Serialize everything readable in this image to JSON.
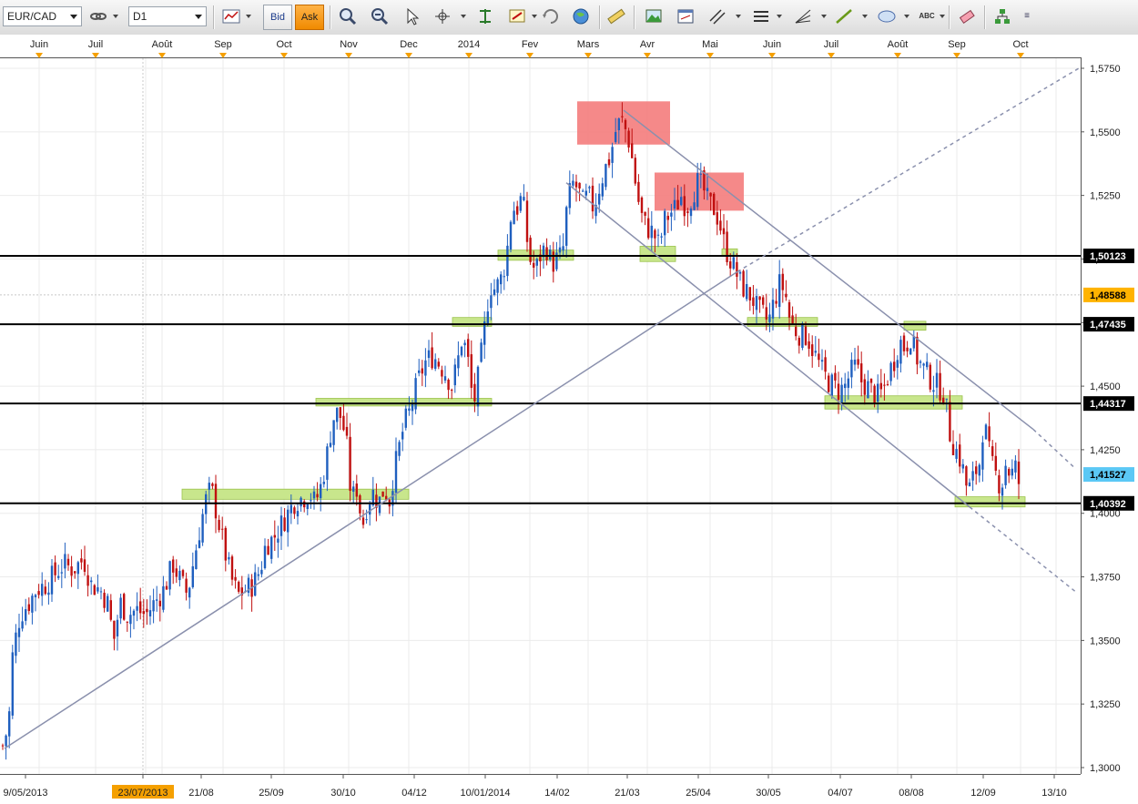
{
  "toolbar": {
    "symbol": "EUR/CAD",
    "timeframe": "D1",
    "bid_label": "Bid",
    "ask_label": "Ask",
    "abc_label": "ABC"
  },
  "colors": {
    "bull": "#1f5fbf",
    "bear": "#c01010",
    "zone_green": "#c8e68c",
    "zone_red": "#f47c7c",
    "trendline": "#8a90ad",
    "orange_marker": "#f5a000",
    "current_price_bg": "#5bc8f5",
    "orange_price_bg": "#ffb300"
  },
  "chart_data": {
    "type": "candlestick",
    "symbol": "EUR/CAD",
    "timeframe": "D1",
    "ylim": [
      1.3,
      1.58
    ],
    "y_ticks": [
      "1,3000",
      "1,3250",
      "1,3500",
      "1,3750",
      "1,4000",
      "1,4250",
      "1,4500",
      "1,4750",
      "1,5000",
      "1,5250",
      "1,5500",
      "1,5750"
    ],
    "month_labels": [
      "Juin",
      "Juil",
      "Août",
      "Sep",
      "Oct",
      "Nov",
      "Dec",
      "2014",
      "Fev",
      "Mars",
      "Avr",
      "Mai",
      "Juin",
      "Juil",
      "Août",
      "Sep",
      "Oct"
    ],
    "date_labels": [
      "9/05/2013",
      "23/07/2013",
      "21/08",
      "25/09",
      "30/10",
      "04/12",
      "10/01/2014",
      "14/02",
      "21/03",
      "25/04",
      "30/05",
      "04/07",
      "08/08",
      "12/09",
      "13/10"
    ],
    "highlighted_date": "23/07/2013",
    "price_labels": [
      {
        "text": "1,50123",
        "value": 1.50123,
        "style": "black"
      },
      {
        "text": "1,48588",
        "value": 1.48588,
        "style": "orange"
      },
      {
        "text": "1,47435",
        "value": 1.47435,
        "style": "black"
      },
      {
        "text": "1,44317",
        "value": 1.44317,
        "style": "black"
      },
      {
        "text": "1,41527",
        "value": 1.41527,
        "style": "current"
      },
      {
        "text": "1,40392",
        "value": 1.40392,
        "style": "black"
      }
    ],
    "horizontal_levels": [
      1.50123,
      1.47435,
      1.44317,
      1.40392
    ],
    "close_path": [
      [
        0,
        1.31
      ],
      [
        4,
        1.308
      ],
      [
        10,
        1.32
      ],
      [
        14,
        1.345
      ],
      [
        22,
        1.36
      ],
      [
        32,
        1.365
      ],
      [
        40,
        1.37
      ],
      [
        50,
        1.372
      ],
      [
        60,
        1.376
      ],
      [
        70,
        1.38
      ],
      [
        80,
        1.378
      ],
      [
        92,
        1.382
      ],
      [
        100,
        1.372
      ],
      [
        110,
        1.37
      ],
      [
        118,
        1.365
      ],
      [
        125,
        1.35
      ],
      [
        132,
        1.365
      ],
      [
        140,
        1.36
      ],
      [
        150,
        1.362
      ],
      [
        160,
        1.36
      ],
      [
        170,
        1.365
      ],
      [
        180,
        1.37
      ],
      [
        190,
        1.38
      ],
      [
        200,
        1.372
      ],
      [
        206,
        1.368
      ],
      [
        212,
        1.38
      ],
      [
        220,
        1.395
      ],
      [
        226,
        1.405
      ],
      [
        232,
        1.41
      ],
      [
        238,
        1.4
      ],
      [
        244,
        1.39
      ],
      [
        250,
        1.38
      ],
      [
        256,
        1.372
      ],
      [
        262,
        1.368
      ],
      [
        270,
        1.37
      ],
      [
        278,
        1.372
      ],
      [
        286,
        1.378
      ],
      [
        292,
        1.388
      ],
      [
        300,
        1.39
      ],
      [
        308,
        1.395
      ],
      [
        316,
        1.4
      ],
      [
        324,
        1.405
      ],
      [
        332,
        1.406
      ],
      [
        340,
        1.408
      ],
      [
        346,
        1.404
      ],
      [
        352,
        1.41
      ],
      [
        358,
        1.42
      ],
      [
        362,
        1.43
      ],
      [
        368,
        1.44
      ],
      [
        374,
        1.438
      ],
      [
        380,
        1.43
      ],
      [
        386,
        1.405
      ],
      [
        392,
        1.41
      ],
      [
        398,
        1.395
      ],
      [
        404,
        1.405
      ],
      [
        410,
        1.408
      ],
      [
        416,
        1.404
      ],
      [
        422,
        1.41
      ],
      [
        428,
        1.405
      ],
      [
        432,
        1.415
      ],
      [
        438,
        1.425
      ],
      [
        444,
        1.435
      ],
      [
        450,
        1.44
      ],
      [
        456,
        1.448
      ],
      [
        462,
        1.455
      ],
      [
        468,
        1.46
      ],
      [
        476,
        1.462
      ],
      [
        484,
        1.458
      ],
      [
        490,
        1.455
      ],
      [
        496,
        1.45
      ],
      [
        502,
        1.458
      ],
      [
        508,
        1.47
      ],
      [
        514,
        1.46
      ],
      [
        520,
        1.442
      ],
      [
        526,
        1.455
      ],
      [
        532,
        1.472
      ],
      [
        538,
        1.49
      ],
      [
        544,
        1.488
      ],
      [
        550,
        1.492
      ],
      [
        556,
        1.5
      ],
      [
        562,
        1.52
      ],
      [
        568,
        1.52
      ],
      [
        574,
        1.525
      ],
      [
        578,
        1.51
      ],
      [
        582,
        1.5
      ],
      [
        588,
        1.495
      ],
      [
        594,
        1.502
      ],
      [
        600,
        1.505
      ],
      [
        606,
        1.498
      ],
      [
        612,
        1.5
      ],
      [
        618,
        1.502
      ],
      [
        622,
        1.518
      ],
      [
        628,
        1.53
      ],
      [
        634,
        1.528
      ],
      [
        640,
        1.522
      ],
      [
        646,
        1.525
      ],
      [
        652,
        1.52
      ],
      [
        658,
        1.528
      ],
      [
        664,
        1.535
      ],
      [
        670,
        1.54
      ],
      [
        676,
        1.55
      ],
      [
        682,
        1.555
      ],
      [
        686,
        1.552
      ],
      [
        692,
        1.545
      ],
      [
        696,
        1.535
      ],
      [
        700,
        1.525
      ],
      [
        706,
        1.515
      ],
      [
        712,
        1.512
      ],
      [
        718,
        1.51
      ],
      [
        724,
        1.505
      ],
      [
        730,
        1.515
      ],
      [
        736,
        1.518
      ],
      [
        742,
        1.52
      ],
      [
        748,
        1.525
      ],
      [
        754,
        1.52
      ],
      [
        760,
        1.525
      ],
      [
        766,
        1.53
      ],
      [
        772,
        1.528
      ],
      [
        778,
        1.522
      ],
      [
        784,
        1.52
      ],
      [
        790,
        1.515
      ],
      [
        796,
        1.505
      ],
      [
        802,
        1.5
      ],
      [
        808,
        1.495
      ],
      [
        814,
        1.49
      ],
      [
        820,
        1.487
      ],
      [
        826,
        1.485
      ],
      [
        832,
        1.48
      ],
      [
        838,
        1.478
      ],
      [
        844,
        1.475
      ],
      [
        850,
        1.483
      ],
      [
        856,
        1.49
      ],
      [
        862,
        1.488
      ],
      [
        868,
        1.475
      ],
      [
        874,
        1.472
      ],
      [
        880,
        1.47
      ],
      [
        886,
        1.47
      ],
      [
        892,
        1.465
      ],
      [
        898,
        1.46
      ],
      [
        904,
        1.455
      ],
      [
        910,
        1.452
      ],
      [
        916,
        1.45
      ],
      [
        922,
        1.448
      ],
      [
        928,
        1.45
      ],
      [
        934,
        1.455
      ],
      [
        940,
        1.458
      ],
      [
        946,
        1.452
      ],
      [
        952,
        1.45
      ],
      [
        958,
        1.448
      ],
      [
        964,
        1.446
      ],
      [
        970,
        1.448
      ],
      [
        976,
        1.455
      ],
      [
        982,
        1.46
      ],
      [
        988,
        1.468
      ],
      [
        994,
        1.465
      ],
      [
        1000,
        1.47
      ],
      [
        1006,
        1.462
      ],
      [
        1012,
        1.458
      ],
      [
        1018,
        1.455
      ],
      [
        1024,
        1.452
      ],
      [
        1030,
        1.45
      ],
      [
        1036,
        1.448
      ],
      [
        1040,
        1.44
      ],
      [
        1044,
        1.43
      ],
      [
        1050,
        1.425
      ],
      [
        1056,
        1.42
      ],
      [
        1062,
        1.41
      ],
      [
        1066,
        1.41
      ],
      [
        1070,
        1.415
      ],
      [
        1076,
        1.42
      ],
      [
        1080,
        1.435
      ],
      [
        1084,
        1.43
      ],
      [
        1088,
        1.42
      ],
      [
        1094,
        1.415
      ],
      [
        1100,
        1.41
      ],
      [
        1104,
        1.42
      ],
      [
        1110,
        1.415
      ],
      [
        1116,
        1.418
      ],
      [
        1120,
        1.41
      ]
    ],
    "zones_green": [
      {
        "x0": 200,
        "x1": 449,
        "y0": 1.4055,
        "y1": 1.4095
      },
      {
        "x0": 347,
        "x1": 540,
        "y0": 1.4422,
        "y1": 1.4452
      },
      {
        "x0": 497,
        "x1": 540,
        "y0": 1.4735,
        "y1": 1.477
      },
      {
        "x0": 547,
        "x1": 630,
        "y0": 1.4995,
        "y1": 1.5035
      },
      {
        "x0": 703,
        "x1": 742,
        "y0": 1.499,
        "y1": 1.505
      },
      {
        "x0": 793,
        "x1": 810,
        "y0": 1.5015,
        "y1": 1.504
      },
      {
        "x0": 821,
        "x1": 898,
        "y0": 1.4735,
        "y1": 1.477
      },
      {
        "x0": 993,
        "x1": 1017,
        "y0": 1.472,
        "y1": 1.4755
      },
      {
        "x0": 906,
        "x1": 1057,
        "y0": 1.441,
        "y1": 1.4462
      },
      {
        "x0": 1049,
        "x1": 1126,
        "y0": 1.4025,
        "y1": 1.4065
      }
    ],
    "zones_red": [
      {
        "x0": 634,
        "x1": 736,
        "y0": 1.545,
        "y1": 1.562
      },
      {
        "x0": 719,
        "x1": 817,
        "y0": 1.519,
        "y1": 1.534
      }
    ],
    "trendlines": [
      {
        "x0": 5,
        "y0": 1.3075,
        "x1": 810,
        "y1": 1.495,
        "style": "solid"
      },
      {
        "x0": 810,
        "y0": 1.495,
        "x1": 1185,
        "y1": 1.575,
        "style": "dashed"
      },
      {
        "x0": 685,
        "y0": 1.5585,
        "x1": 1135,
        "y1": 1.433,
        "style": "solid"
      },
      {
        "x0": 1135,
        "y0": 1.433,
        "x1": 1180,
        "y1": 1.418,
        "style": "dashed"
      },
      {
        "x0": 622,
        "y0": 1.53,
        "x1": 1065,
        "y1": 1.4025,
        "style": "solid"
      },
      {
        "x0": 1065,
        "y0": 1.4025,
        "x1": 1182,
        "y1": 1.369,
        "style": "dashed"
      }
    ]
  }
}
